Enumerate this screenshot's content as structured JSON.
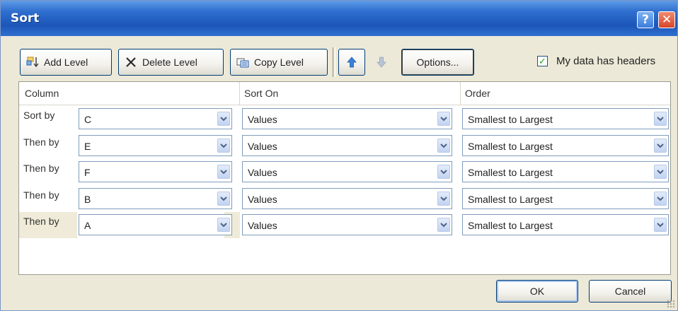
{
  "window": {
    "title": "Sort",
    "help_glyph": "?",
    "close_glyph": "✕"
  },
  "toolbar": {
    "add_level": "Add Level",
    "delete_level": "Delete Level",
    "copy_level": "Copy Level",
    "options": "Options...",
    "headers_label": "My data has headers",
    "headers_checked": true
  },
  "grid": {
    "columns": [
      "Column",
      "Sort On",
      "Order"
    ],
    "rows": [
      {
        "label": "Sort by",
        "column": "C",
        "sort_on": "Values",
        "order": "Smallest to Largest",
        "selected": false
      },
      {
        "label": "Then by",
        "column": "E",
        "sort_on": "Values",
        "order": "Smallest to Largest",
        "selected": false
      },
      {
        "label": "Then by",
        "column": "F",
        "sort_on": "Values",
        "order": "Smallest to Largest",
        "selected": false
      },
      {
        "label": "Then by",
        "column": "B",
        "sort_on": "Values",
        "order": "Smallest to Largest",
        "selected": false
      },
      {
        "label": "Then by",
        "column": "A",
        "sort_on": "Values",
        "order": "Smallest to Largest",
        "selected": true
      }
    ]
  },
  "footer": {
    "ok": "OK",
    "cancel": "Cancel"
  },
  "colors": {
    "titlebar": "#1c56b8",
    "dialog_bg": "#ece9d8",
    "check": "#21a121",
    "selected_row": "#efebd8"
  }
}
